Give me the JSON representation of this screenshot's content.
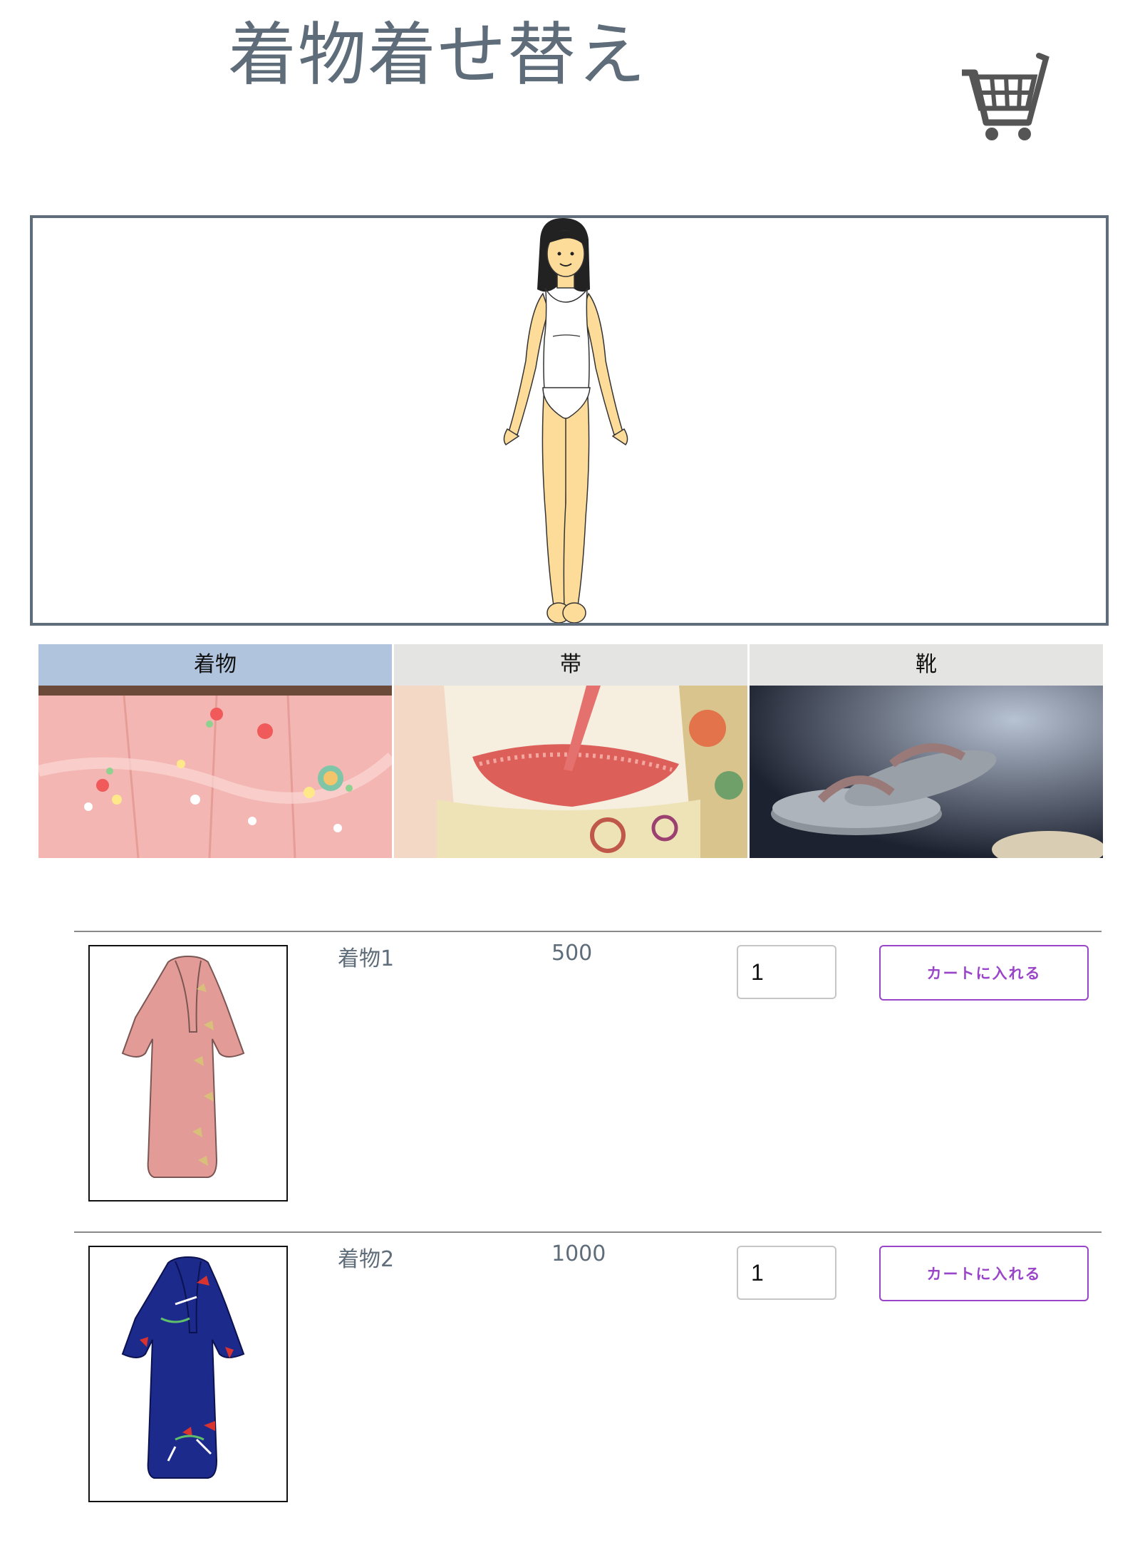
{
  "header": {
    "title": "着物着せ替え",
    "cart_icon": "shopping-cart-icon"
  },
  "tabs": [
    {
      "label": "着物",
      "active": true
    },
    {
      "label": "帯",
      "active": false
    },
    {
      "label": "靴",
      "active": false
    }
  ],
  "products": [
    {
      "name": "着物1",
      "price": "500",
      "quantity": "1",
      "button_label": "カートに入れる",
      "color": "#e39b97"
    },
    {
      "name": "着物2",
      "price": "1000",
      "quantity": "1",
      "button_label": "カートに入れる",
      "color": "#1c2a8c"
    }
  ],
  "colors": {
    "title": "#5f6d7a",
    "active_tab": "#b1c4dd",
    "inactive_tab": "#e4e4e2",
    "button_accent": "#9a45c9"
  }
}
